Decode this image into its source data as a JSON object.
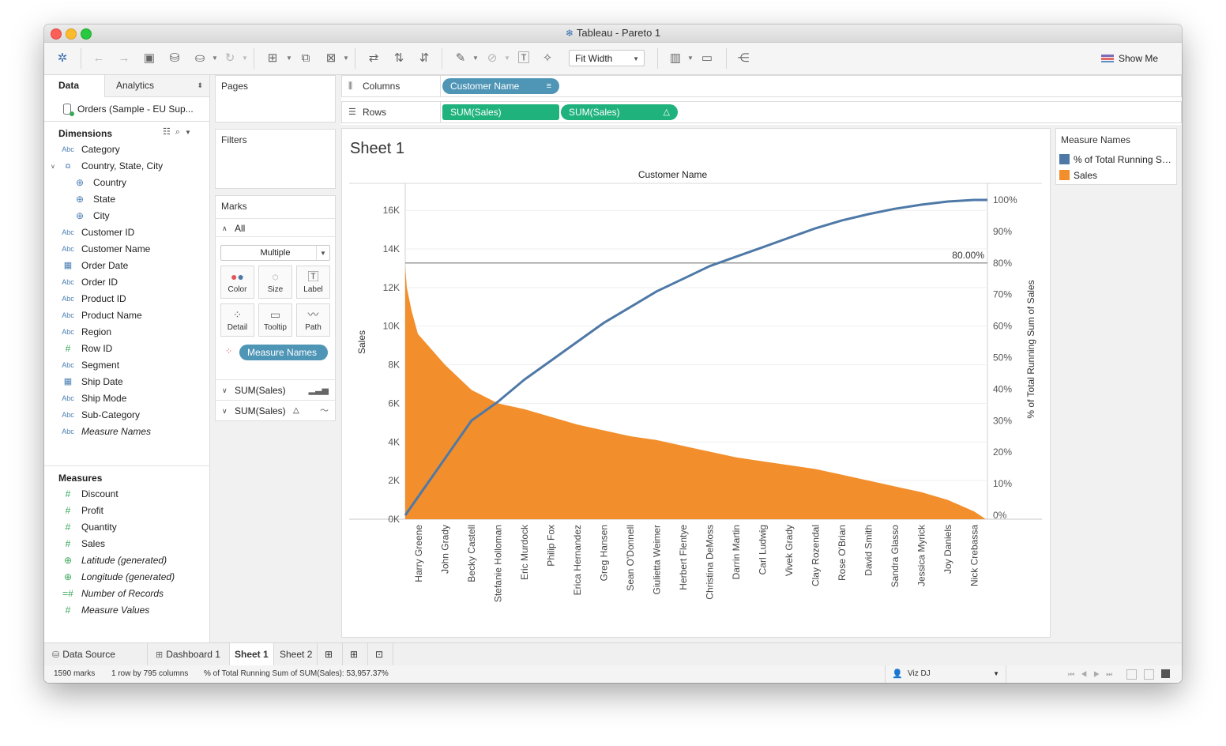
{
  "window": {
    "title": "Tableau - Pareto 1"
  },
  "toolbar": {
    "fit": "Fit Width",
    "show_me": "Show Me"
  },
  "data_pane": {
    "tab_data": "Data",
    "tab_analytics": "Analytics",
    "datasource": "Orders (Sample - EU Sup...",
    "dimensions_label": "Dimensions",
    "measures_label": "Measures",
    "dimensions": [
      {
        "icon": "Abc",
        "label": "Category"
      },
      {
        "icon": "hierarchy",
        "label": "Country, State, City"
      },
      {
        "icon": "globe",
        "label": "Country"
      },
      {
        "icon": "globe",
        "label": "State"
      },
      {
        "icon": "globe",
        "label": "City"
      },
      {
        "icon": "Abc",
        "label": "Customer ID"
      },
      {
        "icon": "Abc",
        "label": "Customer Name"
      },
      {
        "icon": "calendar",
        "label": "Order Date"
      },
      {
        "icon": "Abc",
        "label": "Order ID"
      },
      {
        "icon": "Abc",
        "label": "Product ID"
      },
      {
        "icon": "Abc",
        "label": "Product Name"
      },
      {
        "icon": "Abc",
        "label": "Region"
      },
      {
        "icon": "#",
        "label": "Row ID"
      },
      {
        "icon": "Abc",
        "label": "Segment"
      },
      {
        "icon": "calendar",
        "label": "Ship Date"
      },
      {
        "icon": "Abc",
        "label": "Ship Mode"
      },
      {
        "icon": "Abc",
        "label": "Sub-Category"
      },
      {
        "icon": "Abc",
        "label": "Measure Names"
      }
    ],
    "measures": [
      {
        "icon": "#",
        "label": "Discount"
      },
      {
        "icon": "#",
        "label": "Profit"
      },
      {
        "icon": "#",
        "label": "Quantity"
      },
      {
        "icon": "#",
        "label": "Sales"
      },
      {
        "icon": "globe",
        "label": "Latitude (generated)"
      },
      {
        "icon": "globe",
        "label": "Longitude (generated)"
      },
      {
        "icon": "=#",
        "label": "Number of Records"
      },
      {
        "icon": "#",
        "label": "Measure Values"
      }
    ]
  },
  "cards": {
    "pages": "Pages",
    "filters": "Filters",
    "marks": "Marks",
    "all": "All",
    "mark_type": "Multiple",
    "buttons": [
      "Color",
      "Size",
      "Label",
      "Detail",
      "Tooltip",
      "Path"
    ],
    "color_pill": "Measure Names",
    "sum1": "SUM(Sales)",
    "sum2": "SUM(Sales)"
  },
  "shelves": {
    "columns_label": "Columns",
    "rows_label": "Rows",
    "columns_pill": "Customer Name",
    "rows_pill1": "SUM(Sales)",
    "rows_pill2": "SUM(Sales)"
  },
  "sheet": {
    "title": "Sheet 1"
  },
  "legend": {
    "title": "Measure Names",
    "items": [
      {
        "label": "% of Total Running Sum of Sales",
        "color": "#4e79a7"
      },
      {
        "label": "Sales",
        "color": "#f28e2b"
      }
    ]
  },
  "chart_data": {
    "type": "bar",
    "title": "Customer Name",
    "xlabel": "Customer Name",
    "ylabel": "Sales",
    "y2label": "% of Total Running Sum of Sales",
    "ylim": [
      0,
      17400
    ],
    "y2lim": [
      0,
      1.0
    ],
    "yticks": [
      "0K",
      "2K",
      "4K",
      "6K",
      "8K",
      "10K",
      "12K",
      "14K",
      "16K"
    ],
    "y2ticks": [
      "0%",
      "10%",
      "20%",
      "30%",
      "40%",
      "50%",
      "60%",
      "70%",
      "80%",
      "90%",
      "100%"
    ],
    "reference_line": {
      "value": 0.8,
      "label": "80.00%"
    },
    "grid": true,
    "categories": [
      "Harry Greene",
      "John Grady",
      "Becky Castell",
      "Stefanie Holloman",
      "Eric Murdock",
      "Philip Fox",
      "Erica Hernandez",
      "Greg Hansen",
      "Sean O'Donnell",
      "Giulietta Weimer",
      "Herbert Flentye",
      "Christina DeMoss",
      "Darrin Martin",
      "Carl Ludwig",
      "Vivek Grady",
      "Clay Rozendal",
      "Rose O'Brian",
      "David Smith",
      "Sandra Glasso",
      "Jessica Myrick",
      "Joy Daniels",
      "Nick Crebassa"
    ],
    "series": [
      {
        "name": "Sales",
        "color": "#f28e2b",
        "values": [
          13100,
          8000,
          6700,
          6000,
          5700,
          5300,
          4900,
          4600,
          4300,
          4100,
          3800,
          3500,
          3200,
          3000,
          2800,
          2600,
          2300,
          2000,
          1700,
          1400,
          1000,
          400
        ]
      },
      {
        "name": "% of Total Running Sum of Sales",
        "color": "#4e79a7",
        "values": [
          0.0,
          0.18,
          0.3,
          0.36,
          0.43,
          0.49,
          0.55,
          0.61,
          0.66,
          0.71,
          0.75,
          0.79,
          0.82,
          0.85,
          0.88,
          0.91,
          0.935,
          0.955,
          0.972,
          0.985,
          0.995,
          1.0
        ]
      }
    ]
  },
  "tabs": {
    "datasource": "Data Source",
    "dashboard1": "Dashboard 1",
    "sheet1": "Sheet 1",
    "sheet2": "Sheet 2"
  },
  "status": {
    "marks": "1590 marks",
    "rows": "1 row by 795 columns",
    "total": "% of Total Running Sum of SUM(Sales): 53,957.37%",
    "user": "Viz DJ"
  }
}
